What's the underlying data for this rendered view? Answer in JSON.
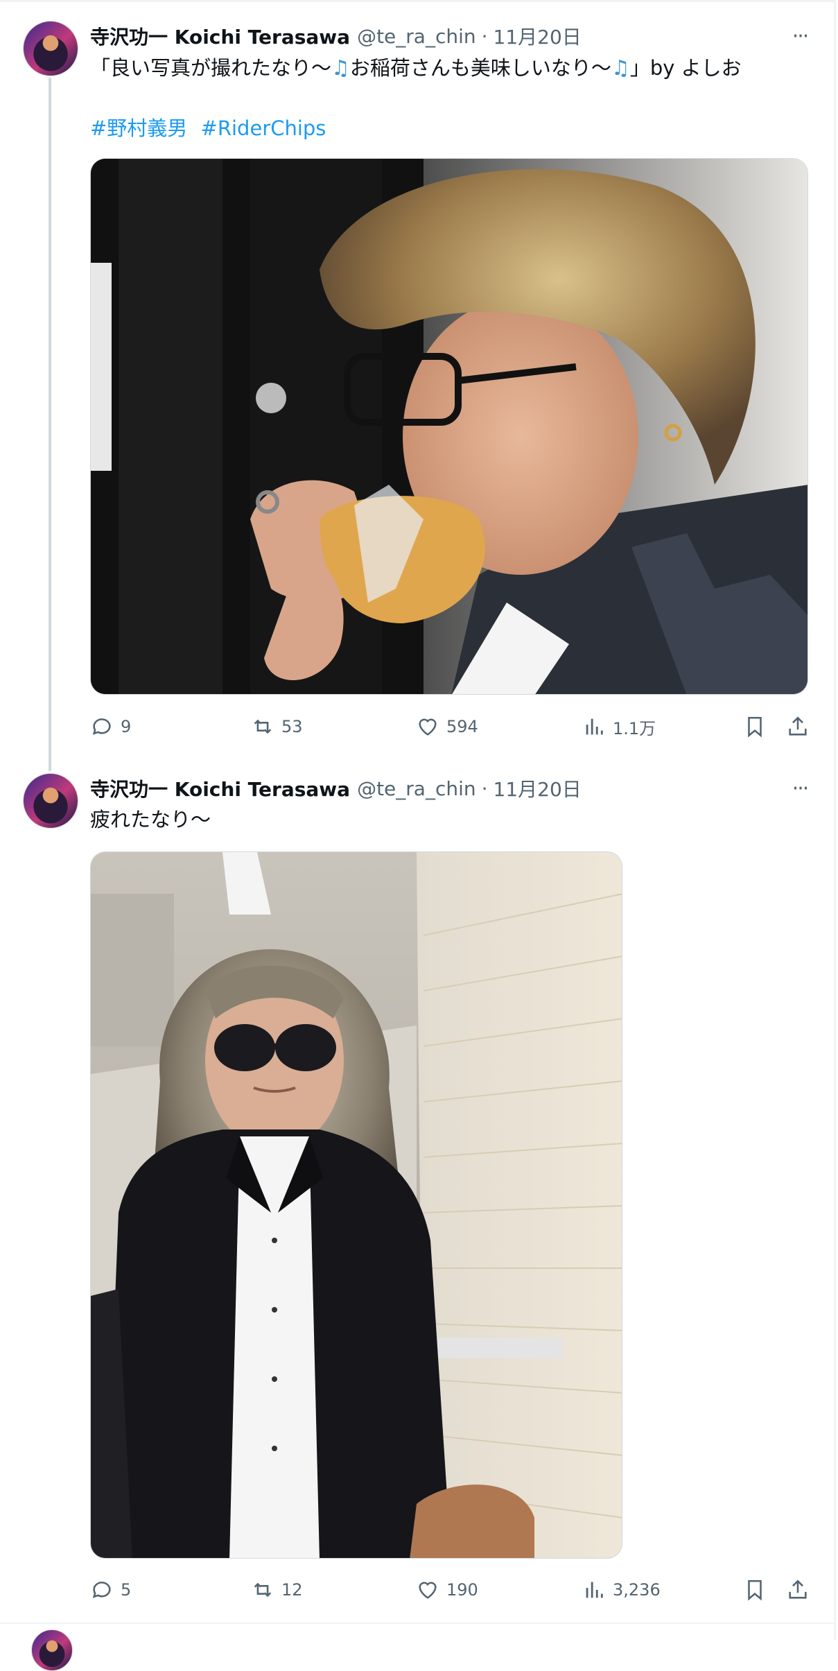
{
  "tweets": [
    {
      "author_name": "寺沢功一 Koichi Terasawa",
      "handle": "@te_ra_chin",
      "separator": "·",
      "date": "11月20日",
      "more": "···",
      "text_part1": "「良い写真が撮れたなり〜",
      "text_part2": "お稲荷さんも美味しいなり〜",
      "text_part3": "」by よしお",
      "note_icon": "♫",
      "hashtags": [
        "#野村義男",
        "#RiderChips"
      ],
      "image_alt": "photo-man-eating-inari",
      "replies": "9",
      "retweets": "53",
      "likes": "594",
      "views": "1.1万"
    },
    {
      "author_name": "寺沢功一 Koichi Terasawa",
      "handle": "@te_ra_chin",
      "separator": "·",
      "date": "11月20日",
      "more": "···",
      "text": "疲れたなり〜",
      "image_alt": "photo-man-in-sunglasses",
      "replies": "5",
      "retweets": "12",
      "likes": "190",
      "views": "3,236"
    }
  ],
  "colors": {
    "text": "#0f1419",
    "secondary": "#536471",
    "link": "#1d9bf0",
    "thread_line": "#cfd9de"
  }
}
